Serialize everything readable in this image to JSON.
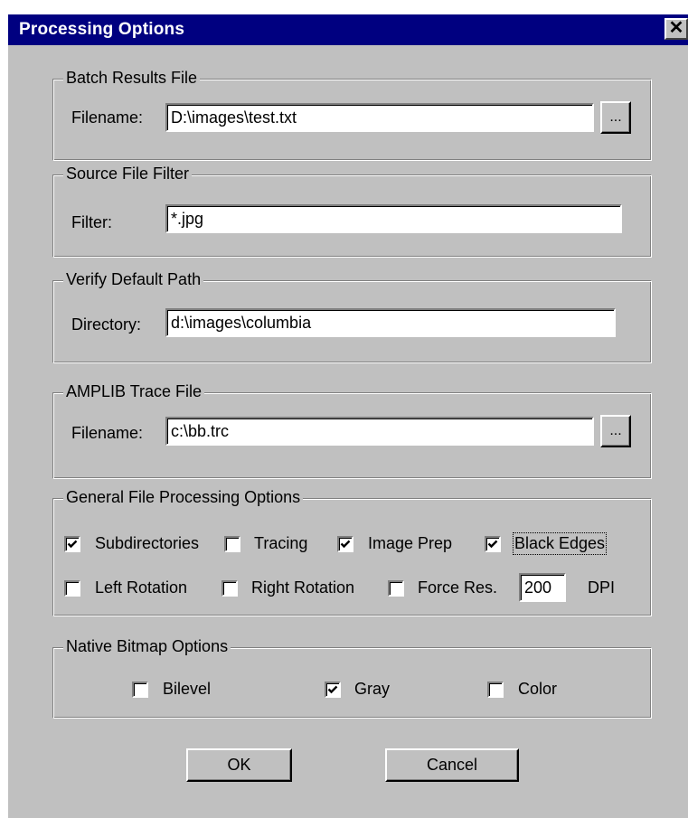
{
  "dialog": {
    "title": "Processing Options",
    "close_label": "✕"
  },
  "batch_results": {
    "legend": "Batch Results File",
    "filename_label": "Filename:",
    "filename_value": "D:\\images\\test.txt",
    "browse_label": "..."
  },
  "source_filter": {
    "legend": "Source File Filter",
    "filter_label": "Filter:",
    "filter_value": "*.jpg"
  },
  "verify_path": {
    "legend": "Verify Default Path",
    "directory_label": "Directory:",
    "directory_value": "d:\\images\\columbia"
  },
  "trace_file": {
    "legend": "AMPLIB Trace File",
    "filename_label": "Filename:",
    "filename_value": "c:\\bb.trc",
    "browse_label": "..."
  },
  "general_options": {
    "legend": "General File Processing Options",
    "subdirectories": {
      "label": "Subdirectories",
      "checked": true
    },
    "tracing": {
      "label": "Tracing",
      "checked": false
    },
    "image_prep": {
      "label": "Image Prep",
      "checked": true
    },
    "black_edges": {
      "label": "Black Edges",
      "checked": true
    },
    "left_rotation": {
      "label": "Left Rotation",
      "checked": false
    },
    "right_rotation": {
      "label": "Right Rotation",
      "checked": false
    },
    "force_res": {
      "label": "Force Res.",
      "checked": false
    },
    "dpi_value": "200",
    "dpi_unit": "DPI"
  },
  "native_bitmap": {
    "legend": "Native Bitmap Options",
    "bilevel": {
      "label": "Bilevel",
      "checked": false
    },
    "gray": {
      "label": "Gray",
      "checked": true
    },
    "color": {
      "label": "Color",
      "checked": false
    }
  },
  "buttons": {
    "ok": "OK",
    "cancel": "Cancel"
  },
  "colors": {
    "title_bar": "#000080",
    "face": "#c0c0c0"
  }
}
